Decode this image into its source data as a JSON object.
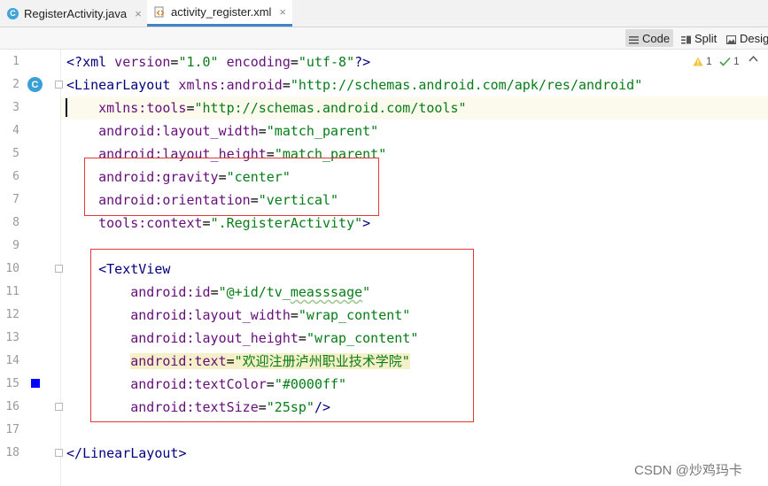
{
  "tabs": [
    {
      "icon": "class-file-icon",
      "glyph": "C",
      "label": "RegisterActivity.java",
      "close": "×"
    },
    {
      "icon": "xml-file-icon",
      "label": "activity_register.xml",
      "close": "×"
    }
  ],
  "view_modes": [
    {
      "icon": "code-view-icon",
      "label": "Code"
    },
    {
      "icon": "split-view-icon",
      "label": "Split"
    },
    {
      "icon": "design-view-icon",
      "label": "Desig"
    }
  ],
  "inspections": {
    "warnings": "1",
    "ok": "1"
  },
  "gutter": {
    "line_numbers": [
      "1",
      "2",
      "3",
      "4",
      "5",
      "6",
      "7",
      "8",
      "9",
      "10",
      "11",
      "12",
      "13",
      "14",
      "15",
      "16",
      "17",
      "18"
    ],
    "class_marker": "C"
  },
  "code": {
    "l1": {
      "a": "<?",
      "b": "xml",
      "c": " version",
      "d": "=",
      "e": "\"1.0\"",
      "f": " encoding",
      "g": "=",
      "h": "\"utf-8\"",
      "i": "?>"
    },
    "l2": {
      "a": "<",
      "b": "LinearLayout",
      "c": " xmlns:",
      "d": "android",
      "e": "=",
      "f": "\"http://schemas.android.com/apk/res/android\""
    },
    "l3": {
      "a": "    xmlns:",
      "b": "tools",
      "c": "=",
      "d": "\"http://schemas.android.com/tools\""
    },
    "l4": {
      "a": "    android",
      "b": ":layout_width",
      "c": "=",
      "d": "\"match_parent\""
    },
    "l5": {
      "a": "    android",
      "b": ":layout_height",
      "c": "=",
      "d": "\"match_parent\""
    },
    "l6": {
      "a": "    android",
      "b": ":gravity",
      "c": "=",
      "d": "\"center\""
    },
    "l7": {
      "a": "    android",
      "b": ":orientation",
      "c": "=",
      "d": "\"vertical\""
    },
    "l8": {
      "a": "    tools",
      "b": ":context",
      "c": "=",
      "d": "\".RegisterActivity\"",
      "e": ">"
    },
    "l10": {
      "a": "    <",
      "b": "TextView"
    },
    "l11": {
      "a": "        android",
      "b": ":id",
      "c": "=",
      "d": "\"@+id/tv_",
      "e": "measssage",
      "f": "\""
    },
    "l12": {
      "a": "        android",
      "b": ":layout_width",
      "c": "=",
      "d": "\"wrap_content\""
    },
    "l13": {
      "a": "        android",
      "b": ":layout_height",
      "c": "=",
      "d": "\"wrap_content\""
    },
    "l14": {
      "a": "android",
      "b": ":text",
      "c": "=",
      "d": "\"欢迎注册泸州职业技术学院\""
    },
    "l15": {
      "a": "        android",
      "b": ":textColor",
      "c": "=",
      "d": "\"#0000ff\""
    },
    "l16": {
      "a": "        android",
      "b": ":textSize",
      "c": "=",
      "d": "\"25sp\"",
      "e": "/>"
    },
    "l18": {
      "a": "</",
      "b": "LinearLayout",
      "c": ">"
    }
  },
  "watermark": "CSDN @炒鸡玛卡",
  "colors": {
    "tag": "#000080",
    "attribute": "#660e7a",
    "value": "#067d17",
    "annotation_box": "#e53935",
    "text_color_swatch": "#0000ff"
  }
}
